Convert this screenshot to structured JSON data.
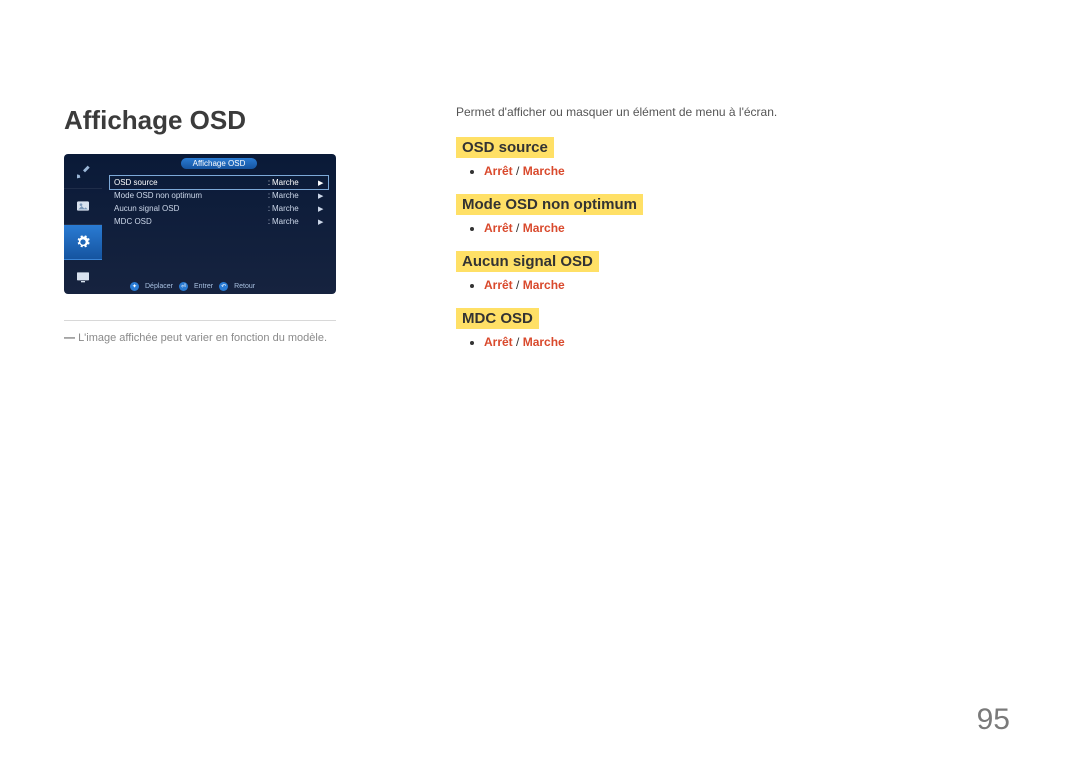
{
  "page": {
    "title": "Affichage OSD",
    "number": "95"
  },
  "osd_panel": {
    "header": "Affichage OSD",
    "rows": [
      {
        "label": "OSD source",
        "value": "Marche"
      },
      {
        "label": "Mode OSD non optimum",
        "value": "Marche"
      },
      {
        "label": "Aucun signal OSD",
        "value": "Marche"
      },
      {
        "label": "MDC OSD",
        "value": "Marche"
      }
    ],
    "footer": {
      "move": "Déplacer",
      "enter": "Entrer",
      "return": "Retour"
    }
  },
  "caption": "L'image affichée peut varier en fonction du modèle.",
  "description": "Permet d'afficher ou masquer un élément de menu à l'écran.",
  "sections": [
    {
      "heading": "OSD source",
      "options": [
        "Arrêt",
        "Marche"
      ]
    },
    {
      "heading": "Mode OSD non optimum",
      "options": [
        "Arrêt",
        "Marche"
      ]
    },
    {
      "heading": "Aucun signal OSD",
      "options": [
        "Arrêt",
        "Marche"
      ]
    },
    {
      "heading": "MDC OSD",
      "options": [
        "Arrêt",
        "Marche"
      ]
    }
  ],
  "separator": " / "
}
